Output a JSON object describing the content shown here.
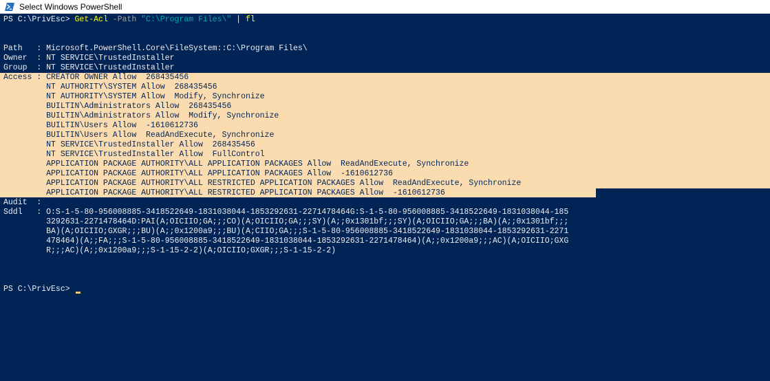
{
  "window": {
    "title": "Select Windows PowerShell",
    "icon": "powershell-icon"
  },
  "command": {
    "prompt": "PS C:\\PrivEsc> ",
    "verb": "Get-Acl",
    "param": " -Path ",
    "path_arg": "\"C:\\Program Files\\\"",
    "pipe": " | ",
    "format_cmd": "fl"
  },
  "output": {
    "path_line": "Path   : Microsoft.PowerShell.Core\\FileSystem::C:\\Program Files\\",
    "owner_line": "Owner  : NT SERVICE\\TrustedInstaller",
    "group_line": "Group  : NT SERVICE\\TrustedInstaller",
    "access_lines": [
      "Access : CREATOR OWNER Allow  268435456",
      "         NT AUTHORITY\\SYSTEM Allow  268435456",
      "         NT AUTHORITY\\SYSTEM Allow  Modify, Synchronize",
      "         BUILTIN\\Administrators Allow  268435456",
      "         BUILTIN\\Administrators Allow  Modify, Synchronize",
      "         BUILTIN\\Users Allow  -1610612736",
      "         BUILTIN\\Users Allow  ReadAndExecute, Synchronize",
      "         NT SERVICE\\TrustedInstaller Allow  268435456",
      "         NT SERVICE\\TrustedInstaller Allow  FullControl",
      "         APPLICATION PACKAGE AUTHORITY\\ALL APPLICATION PACKAGES Allow  ReadAndExecute, Synchronize",
      "         APPLICATION PACKAGE AUTHORITY\\ALL APPLICATION PACKAGES Allow  -1610612736",
      "         APPLICATION PACKAGE AUTHORITY\\ALL RESTRICTED APPLICATION PACKAGES Allow  ReadAndExecute, Synchronize",
      "         APPLICATION PACKAGE AUTHORITY\\ALL RESTRICTED APPLICATION PACKAGES Allow  -1610612736"
    ],
    "audit_line": "Audit  :",
    "sddl_lines": [
      "Sddl   : O:S-1-5-80-956008885-3418522649-1831038044-1853292631-2271478464G:S-1-5-80-956008885-3418522649-1831038044-185",
      "         3292631-2271478464D:PAI(A;OICIIO;GA;;;CO)(A;OICIIO;GA;;;SY)(A;;0x1301bf;;;SY)(A;OICIIO;GA;;;BA)(A;;0x1301bf;;;",
      "         BA)(A;OICIIO;GXGR;;;BU)(A;;0x1200a9;;;BU)(A;CIIO;GA;;;S-1-5-80-956008885-3418522649-1831038044-1853292631-2271",
      "         478464)(A;;FA;;;S-1-5-80-956008885-3418522649-1831038044-1853292631-2271478464)(A;;0x1200a9;;;AC)(A;OICIIO;GXG",
      "         R;;;AC)(A;;0x1200a9;;;S-1-15-2-2)(A;OICIIO;GXGR;;;S-1-15-2-2)"
    ]
  },
  "final_prompt": "PS C:\\PrivEsc> ",
  "colors": {
    "background": "#012456",
    "foreground": "#eeedf0",
    "command_verb": "#ffff00",
    "command_param": "#a0a0a0",
    "command_string": "#00aaaa",
    "selection": "#fbdcb0",
    "cursor": "#f6c870"
  }
}
